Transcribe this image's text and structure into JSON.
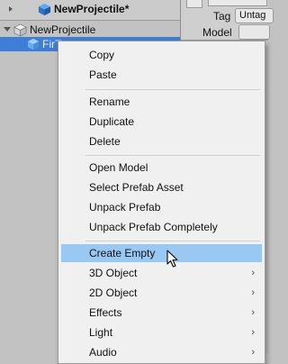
{
  "hierarchy": {
    "title": "NewProjectile*",
    "root_label": "NewProjectile",
    "child_label": "FirTree"
  },
  "inspector": {
    "tag_label": "Tag",
    "tag_value": "Untag",
    "model_label": "Model"
  },
  "menu": {
    "items": [
      {
        "label": "Copy"
      },
      {
        "label": "Paste"
      },
      {
        "label": "Rename"
      },
      {
        "label": "Duplicate"
      },
      {
        "label": "Delete"
      },
      {
        "label": "Open Model"
      },
      {
        "label": "Select Prefab Asset"
      },
      {
        "label": "Unpack Prefab"
      },
      {
        "label": "Unpack Prefab Completely"
      },
      {
        "label": "Create Empty",
        "highlighted": true
      },
      {
        "label": "3D Object",
        "submenu": true
      },
      {
        "label": "2D Object",
        "submenu": true
      },
      {
        "label": "Effects",
        "submenu": true
      },
      {
        "label": "Light",
        "submenu": true
      },
      {
        "label": "Audio",
        "submenu": true
      }
    ],
    "submenu_arrow": "›"
  },
  "colors": {
    "selection": "#3e7ed8",
    "menu_highlight": "#99c9f3",
    "menu_bg": "#f0f0f0"
  }
}
